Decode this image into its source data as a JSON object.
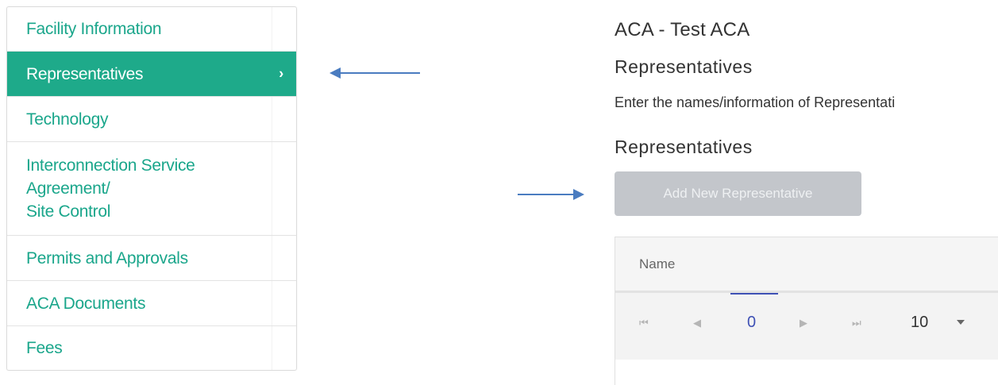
{
  "sidebar": {
    "items": [
      {
        "label": "Facility Information",
        "active": false
      },
      {
        "label": "Representatives",
        "active": true
      },
      {
        "label": "Technology",
        "active": false
      },
      {
        "label_lines": [
          "Interconnection Service",
          "Agreement/",
          "Site Control"
        ],
        "active": false
      },
      {
        "label": "Permits and Approvals",
        "active": false
      },
      {
        "label": "ACA Documents",
        "active": false
      },
      {
        "label": "Fees",
        "active": false
      }
    ],
    "active_chevron_icon": "chevron-right-icon",
    "colors": {
      "link": "#1aa68b",
      "active_bg": "#1eaa8a"
    }
  },
  "main": {
    "title": "ACA - Test ACA",
    "subtitle": "Representatives",
    "description": "Enter the names/information of Representati",
    "section_heading": "Representatives",
    "add_button_label": "Add New Representative",
    "grid": {
      "columns": [
        "Name"
      ],
      "pager": {
        "first_icon": "first-page-icon",
        "prev_icon": "prev-page-icon",
        "next_icon": "next-page-icon",
        "last_icon": "last-page-icon",
        "current_page": "0",
        "page_size": "10",
        "accent": "#3f51b5"
      }
    }
  },
  "annotations": {
    "arrow_color": "#4a7cc0"
  }
}
